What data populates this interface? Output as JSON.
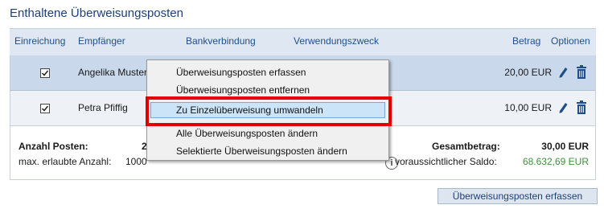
{
  "page": {
    "title": "Enthaltene Überweisungsposten"
  },
  "table": {
    "columns": {
      "einreichung": "Einreichung",
      "empfaenger": "Empfänger",
      "bankverbindung": "Bankverbindung",
      "verwendungszweck": "Verwendungszweck",
      "betrag": "Betrag",
      "optionen": "Optionen"
    },
    "rows": [
      {
        "checked": true,
        "empfaenger": "Angelika Muster",
        "betrag": "20,00 EUR"
      },
      {
        "checked": true,
        "empfaenger": "Petra Pfiffig",
        "betrag": "10,00 EUR"
      }
    ]
  },
  "summary": {
    "anzahl_label": "Anzahl Posten:",
    "anzahl_value": "2",
    "max_label": "max. erlaubte Anzahl:",
    "max_value": "1000",
    "gesamt_label": "Gesamtbetrag:",
    "gesamt_value": "30,00 EUR",
    "saldo_label": "voraussichtlicher Saldo:",
    "saldo_value": "68.632,69 EUR",
    "info_glyph": "i"
  },
  "actions": {
    "add_label": "Überweisungsposten erfassen"
  },
  "context_menu": {
    "items": [
      "Überweisungsposten erfassen",
      "Überweisungsposten entfernen",
      "Zu Einzelüberweisung umwandeln",
      "Alle Überweisungsposten ändern",
      "Selektierte Überweisungsposten ändern"
    ],
    "highlighted_index": 2
  },
  "colors": {
    "header_text": "#1f4f8a",
    "title": "#1f3f73",
    "saldo": "#3d8f3d",
    "highlight_frame": "#e00000",
    "icon": "#1f4f8a"
  },
  "icons": {
    "edit": "pencil-icon",
    "delete": "trash-icon",
    "checkbox": "checkmark-icon"
  }
}
